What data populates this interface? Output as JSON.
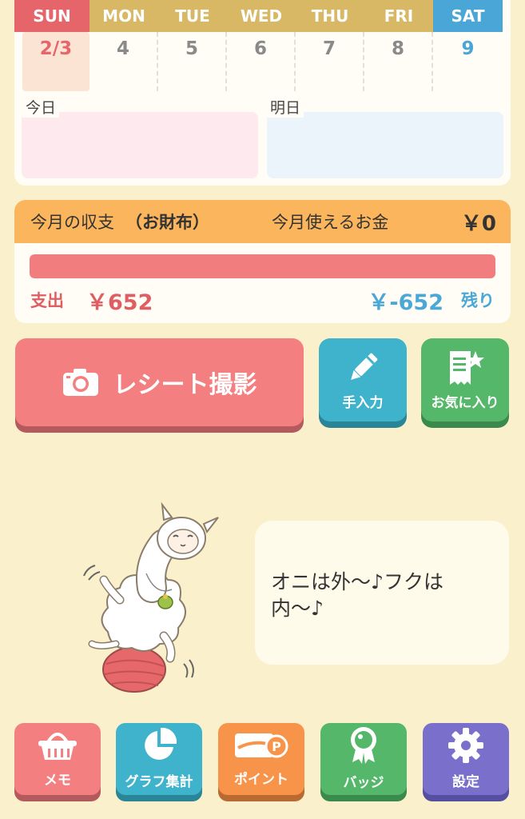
{
  "calendar": {
    "days": [
      "SUN",
      "MON",
      "TUE",
      "WED",
      "THU",
      "FRI",
      "SAT"
    ],
    "dates": [
      "2/3",
      "4",
      "5",
      "6",
      "7",
      "8",
      "9"
    ],
    "today_label": "今日",
    "tomorrow_label": "明日"
  },
  "budget": {
    "title": "今月の収支",
    "wallet": "（お財布）",
    "available_label": "今月使えるお金",
    "available_amount": "￥0",
    "spent_fraction": 1.0,
    "spent_label": "支出",
    "spent_amount": "￥652",
    "remaining_amount": "￥-652",
    "remaining_label": "残り"
  },
  "actions": {
    "receipt": "レシート撮影",
    "manual": "手入力",
    "favorites": "お気に入り"
  },
  "speech": {
    "line1": "オニは外〜♪フクは",
    "line2": "内〜♪"
  },
  "nav": {
    "memo": "メモ",
    "graph": "グラフ集計",
    "point": "ポイント",
    "badge": "バッジ",
    "settings": "設定"
  },
  "colors": {
    "sunday": "#e5656b",
    "saturday": "#4aa6d7",
    "weekday_header": "#d8b765",
    "budget_header": "#fbb55c",
    "expense": "#e15d64",
    "remaining": "#49a8d6"
  }
}
